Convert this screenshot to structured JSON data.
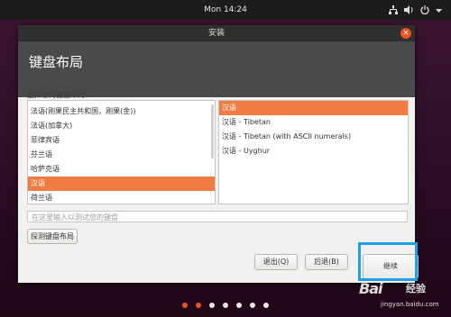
{
  "topbar": {
    "clock": "Mon 14:24",
    "icons": [
      "network-icon",
      "volume-icon",
      "power-icon",
      "menu-arrow-icon"
    ]
  },
  "window": {
    "title": "安装",
    "header": "键盘布局",
    "prompt": "选择您的键盘布局：",
    "layouts": [
      "法语(刚果民主共和国，刚果(金))",
      "法语(加拿大)",
      "菲律宾语",
      "芬兰语",
      "哈萨克语",
      "汉语",
      "荷兰语"
    ],
    "selected_layout": "汉语",
    "variants": [
      "汉语",
      "汉语 - Tibetan",
      "汉语 - Tibetan (with ASCII numerals)",
      "汉语 - Uyghur"
    ],
    "selected_variant": "汉语",
    "test_placeholder": "在这里输入以测试您的键盘",
    "detect_label": "探测键盘布局",
    "quit_label": "退出(Q)",
    "back_label": "后退(B)",
    "continue_label": "继续"
  },
  "progress": {
    "total_steps": 7,
    "completed": 2
  },
  "watermark": {
    "brand": "Bai",
    "brand2": "经验",
    "url": "jingyan.baidu.com"
  },
  "colors": {
    "accent": "#e95420",
    "selection": "#f07c44",
    "highlight_box": "#1ea0e8"
  }
}
